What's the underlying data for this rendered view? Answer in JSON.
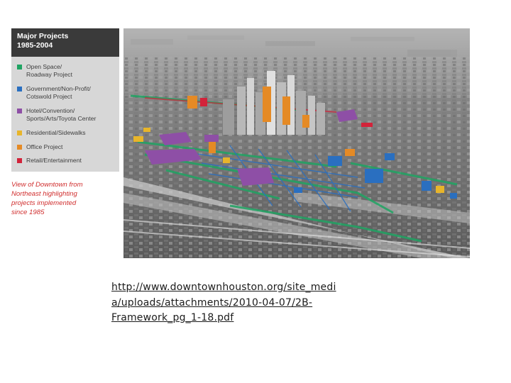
{
  "legend": {
    "title": "Major Projects\n1985-2004",
    "items": [
      {
        "label": "Open Space/\nRoadway Project",
        "color": "#1fa463"
      },
      {
        "label": "Government/Non-Profit/\nCotswold Project",
        "color": "#2a6fc0"
      },
      {
        "label": "Hotel/Convention/\nSports/Arts/Toyota Center",
        "color": "#8e4fa6"
      },
      {
        "label": "Residential/Sidewalks",
        "color": "#e8b52a"
      },
      {
        "label": "Office Project",
        "color": "#e58a25"
      },
      {
        "label": "Retail/Entertainment",
        "color": "#d2233a"
      }
    ]
  },
  "caption": "View of Downtown from\nNortheast highlighting\nprojects implemented\nsince 1985",
  "source_link": "http://www.downtownhouston.org/site_medi\na/uploads/attachments/2010-04-07/2B-\nFramework_pg_1-18.pdf"
}
